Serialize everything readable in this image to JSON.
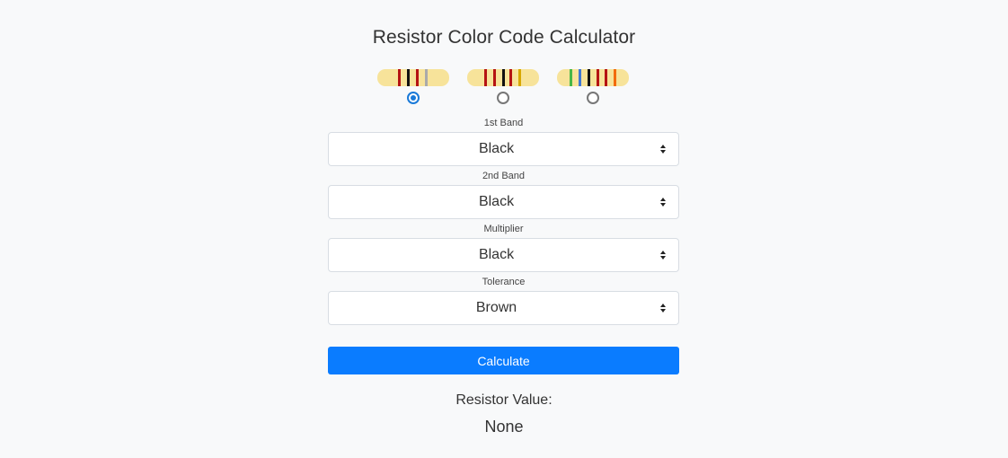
{
  "title": "Resistor Color Code Calculator",
  "resistor_options": [
    {
      "name": "4-band",
      "bands": [
        "#b51313",
        "#111111",
        "#b51313",
        "#aaaaaa"
      ],
      "selected": true
    },
    {
      "name": "5-band",
      "bands": [
        "#b51313",
        "#b51313",
        "#111111",
        "#b51313",
        "#d7a800"
      ],
      "selected": false
    },
    {
      "name": "6-band",
      "bands": [
        "#47b847",
        "#3f77d4",
        "#111111",
        "#b51313",
        "#b51313",
        "#f26b0c"
      ],
      "selected": false
    }
  ],
  "fields": [
    {
      "label": "1st Band",
      "value": "Black"
    },
    {
      "label": "2nd Band",
      "value": "Black"
    },
    {
      "label": "Multiplier",
      "value": "Black"
    },
    {
      "label": "Tolerance",
      "value": "Brown"
    }
  ],
  "calculate_label": "Calculate",
  "result": {
    "label": "Resistor Value:",
    "value": "None"
  },
  "colors": {
    "background": "#f8f9fa",
    "button": "#0a7cff",
    "resistor_body": "#f7e39a",
    "radio_selected": "#1a7ad8"
  }
}
